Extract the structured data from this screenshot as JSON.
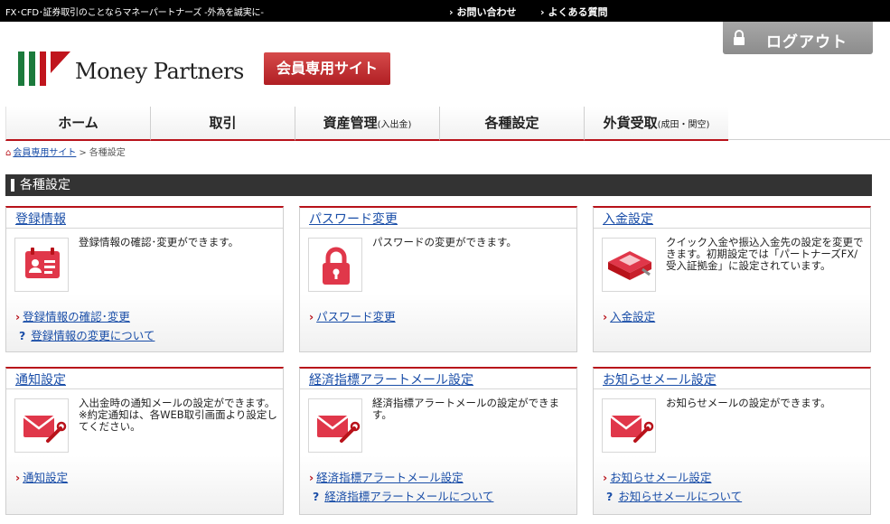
{
  "topbar": {
    "tagline": "FX･CFD･証券取引のことならマネーパートナーズ -外為を誠実に-",
    "links": [
      "お問い合わせ",
      "よくある質問"
    ]
  },
  "logout_label": "ログアウト",
  "logo_text": "Money Partners",
  "member_badge": "会員専用サイト",
  "nav": [
    {
      "label": "ホーム",
      "sub": ""
    },
    {
      "label": "取引",
      "sub": ""
    },
    {
      "label": "資産管理",
      "sub": "(入出金)"
    },
    {
      "label": "各種設定",
      "sub": ""
    },
    {
      "label": "外貨受取",
      "sub": "(成田・関空)"
    }
  ],
  "breadcrumb": {
    "home": "会員専用サイト",
    "current": "各種設定"
  },
  "section_title": "各種設定",
  "cards": [
    {
      "title": "登録情報",
      "icon": "registration-card-icon",
      "desc": "登録情報の確認･変更ができます。",
      "links": [
        {
          "type": "arrow",
          "text": "登録情報の確認･変更"
        },
        {
          "type": "help",
          "text": "登録情報の変更について"
        }
      ]
    },
    {
      "title": "パスワード変更",
      "icon": "padlock-icon",
      "desc": "パスワードの変更ができます。",
      "links": [
        {
          "type": "arrow",
          "text": "パスワード変更"
        }
      ]
    },
    {
      "title": "入金設定",
      "icon": "deposit-tray-icon",
      "desc": "クイック入金や振込入金先の設定を変更できます。初期設定では「パートナーズFX/受入証拠金」に設定されています。",
      "links": [
        {
          "type": "arrow",
          "text": "入金設定"
        }
      ]
    },
    {
      "title": "通知設定",
      "icon": "mail-settings-icon",
      "desc": "入出金時の通知メールの設定ができます。\n※約定通知は、各WEB取引画面より設定してください。",
      "links": [
        {
          "type": "arrow",
          "text": "通知設定"
        }
      ]
    },
    {
      "title": "経済指標アラートメール設定",
      "icon": "mail-settings-icon",
      "desc": "経済指標アラートメールの設定ができます。",
      "links": [
        {
          "type": "arrow",
          "text": "経済指標アラートメール設定"
        },
        {
          "type": "help",
          "text": "経済指標アラートメールについて"
        }
      ]
    },
    {
      "title": "お知らせメール設定",
      "icon": "mail-settings-icon",
      "desc": "お知らせメールの設定ができます。",
      "links": [
        {
          "type": "arrow",
          "text": "お知らせメール設定"
        },
        {
          "type": "help",
          "text": "お知らせメールについて"
        }
      ]
    }
  ],
  "colors": {
    "brand_red": "#b8121a",
    "link_blue": "#1a4ea8",
    "topbar": "#000000",
    "section_head": "#333333"
  }
}
